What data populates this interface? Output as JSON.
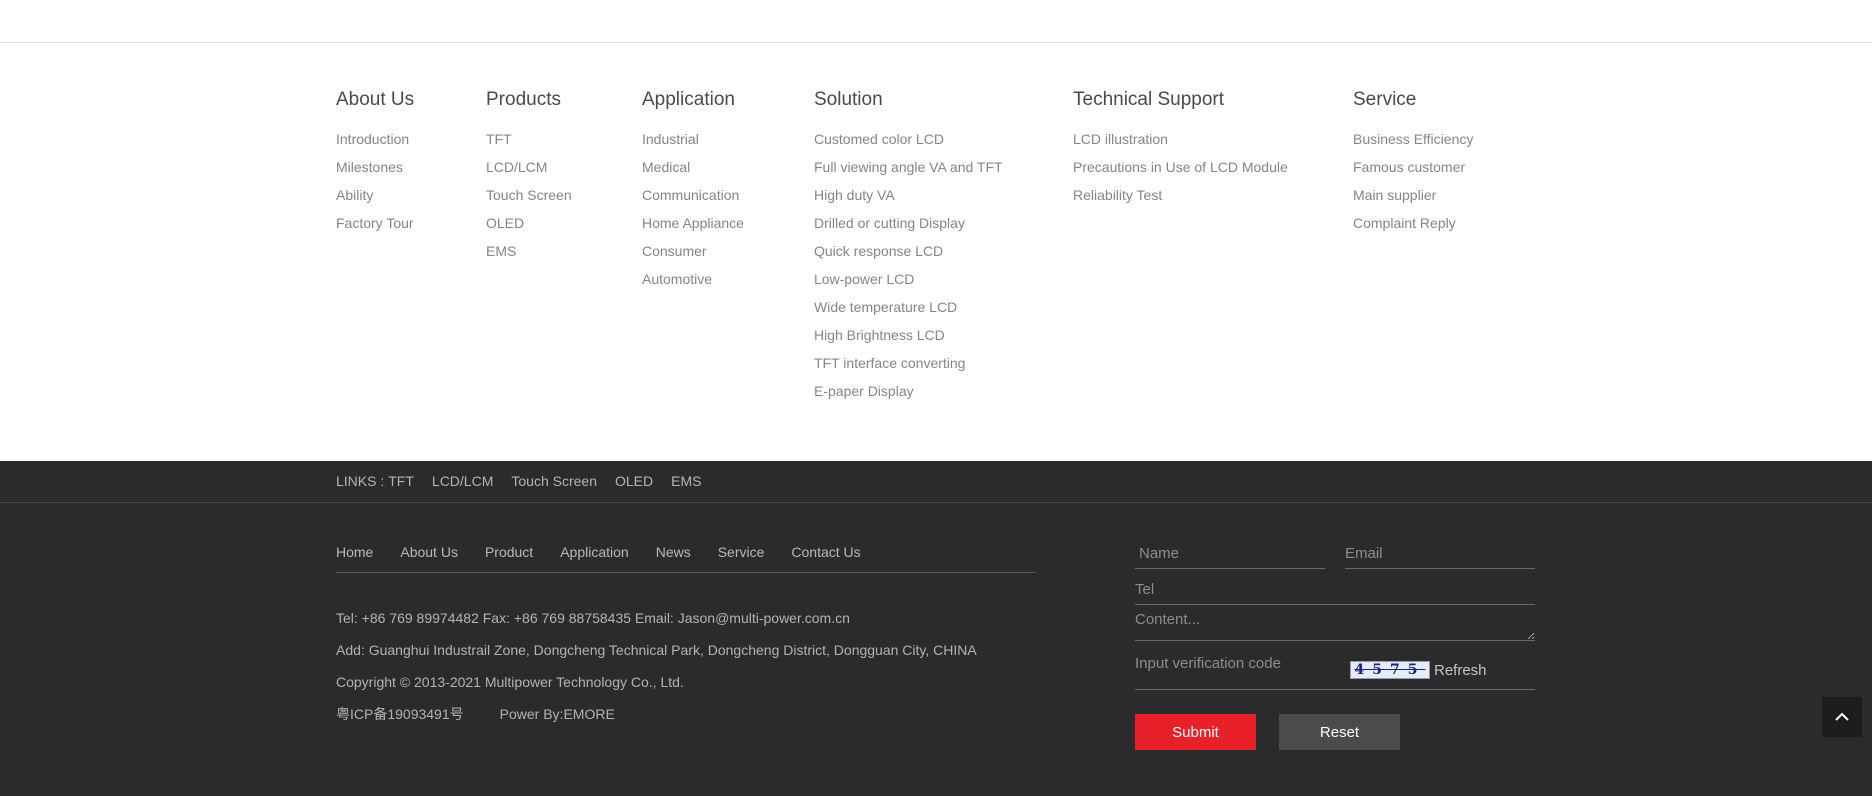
{
  "columns": [
    {
      "title": "About Us",
      "items": [
        "Introduction",
        "Milestones",
        "Ability",
        "Factory Tour"
      ]
    },
    {
      "title": "Products",
      "items": [
        "TFT",
        "LCD/LCM",
        "Touch Screen",
        "OLED",
        "EMS"
      ]
    },
    {
      "title": "Application",
      "items": [
        "Industrial",
        "Medical",
        "Communication",
        "Home Appliance",
        "Consumer",
        "Automotive"
      ]
    },
    {
      "title": "Solution",
      "items": [
        "Customed color LCD",
        "Full viewing angle VA and TFT",
        "High duty VA",
        "Drilled or cutting Display",
        "Quick response LCD",
        "Low-power LCD",
        "Wide temperature LCD",
        "High Brightness LCD",
        "TFT interface converting",
        "E-paper Display"
      ]
    },
    {
      "title": "Technical Support",
      "items": [
        "LCD illustration",
        "Precautions in Use of LCD Module",
        "Reliability Test"
      ]
    },
    {
      "title": "Service",
      "items": [
        "Business Efficiency",
        "Famous customer",
        "Main supplier",
        "Complaint Reply"
      ]
    }
  ],
  "links": {
    "label": "LINKS :",
    "items": [
      "TFT",
      "LCD/LCM",
      "Touch Screen",
      "OLED",
      "EMS"
    ]
  },
  "footer_nav": [
    "Home",
    "About Us",
    "Product",
    "Application",
    "News",
    "Service",
    "Contact Us"
  ],
  "contact": {
    "line1": "Tel: +86 769 89974482 Fax: +86 769 88758435 Email: Jason@multi-power.com.cn",
    "line2": "Add: Guanghui Industrail Zone, Dongcheng Technical Park, Dongcheng District, Dongguan City, CHINA",
    "line3": "Copyright © 2013-2021 Multipower Technology Co., Ltd.",
    "icp": "粤ICP备19093491号",
    "power": "Power By:EMORE"
  },
  "form": {
    "name_placeholder": "Name",
    "email_placeholder": "Email",
    "tel_placeholder": "Tel",
    "content_placeholder": "Content...",
    "code_placeholder": "Input verification code",
    "captcha": "4575",
    "refresh_label": "Refresh",
    "submit_label": "Submit",
    "reset_label": "Reset"
  },
  "icons": {
    "back_to_top": "chevron-up-icon"
  },
  "colors": {
    "footer_bg": "#2b2b2d",
    "submit": "#e8202a",
    "reset": "#4b4b4d"
  }
}
